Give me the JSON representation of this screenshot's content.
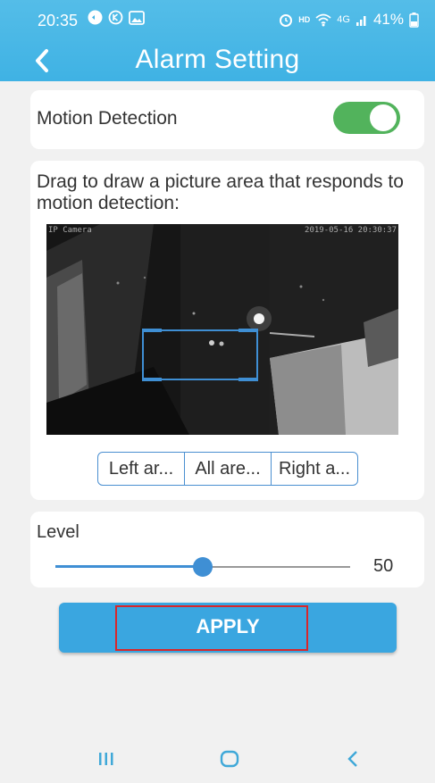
{
  "status_bar": {
    "time": "20:35",
    "network": "4G",
    "battery": "41%"
  },
  "header": {
    "title": "Alarm Setting"
  },
  "motion_detection": {
    "label": "Motion Detection",
    "enabled": true
  },
  "area": {
    "description": "Drag to draw a picture area that responds to motion detection:",
    "camera_name": "IP Camera",
    "timestamp": "2019-05-16 20:30:37",
    "buttons": [
      "Left ar...",
      "All are...",
      "Right a..."
    ]
  },
  "level": {
    "label": "Level",
    "value": "50",
    "fraction": 0.5
  },
  "apply": {
    "label": "APPLY"
  },
  "colors": {
    "accent": "#3fb2e4",
    "toggle_on": "#52b35c",
    "selection": "#3f8fd4",
    "highlight": "#d9262a"
  }
}
